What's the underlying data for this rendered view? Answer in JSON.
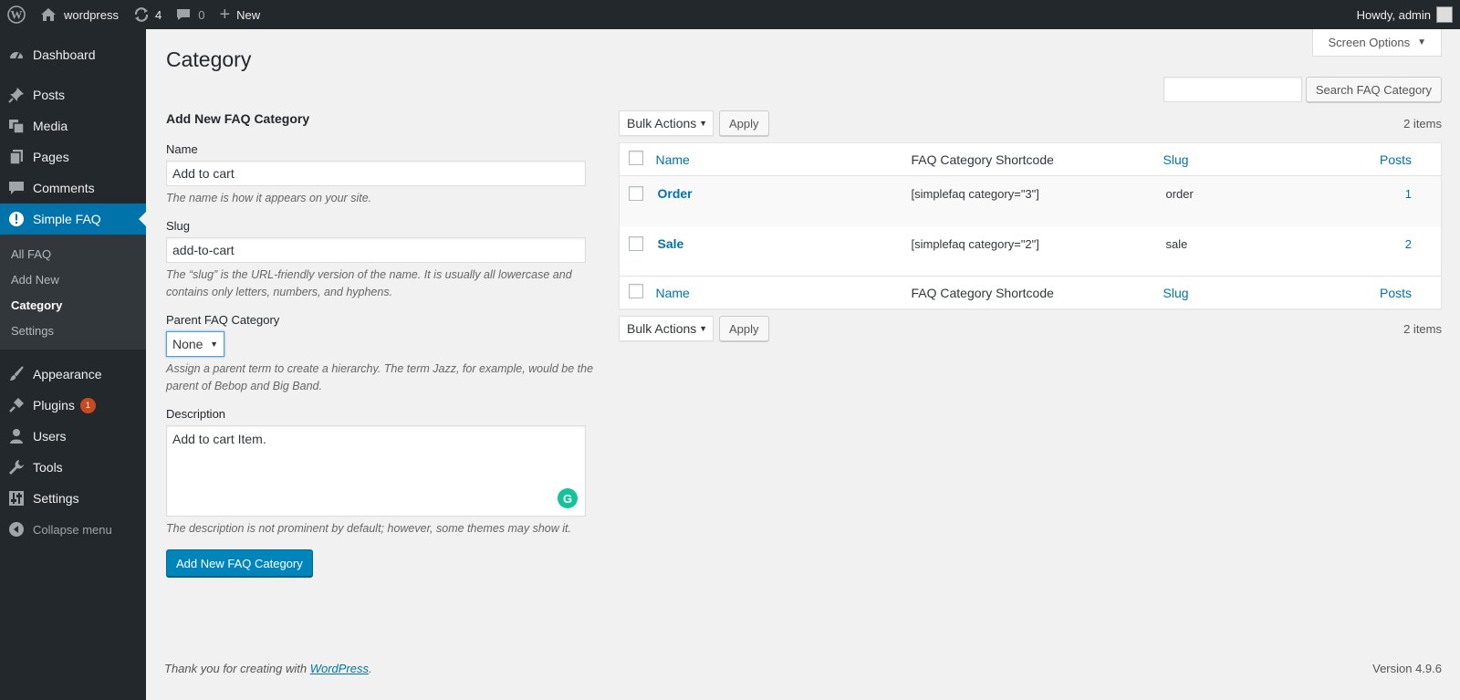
{
  "adminbar": {
    "site_name": "wordpress",
    "updates_count": "4",
    "comments_count": "0",
    "new_label": "New",
    "howdy": "Howdy, admin"
  },
  "sidebar": {
    "items": [
      {
        "label": "Dashboard",
        "icon": "dashboard-icon"
      },
      {
        "label": "Posts",
        "icon": "pin-icon"
      },
      {
        "label": "Media",
        "icon": "media-icon"
      },
      {
        "label": "Pages",
        "icon": "pages-icon"
      },
      {
        "label": "Comments",
        "icon": "comments-icon"
      },
      {
        "label": "Simple FAQ",
        "icon": "exclamation-icon"
      }
    ],
    "submenu": [
      "All FAQ",
      "Add New",
      "Category",
      "Settings"
    ],
    "items2": [
      {
        "label": "Appearance",
        "icon": "brush-icon"
      },
      {
        "label": "Plugins",
        "icon": "plug-icon",
        "badge": "1"
      },
      {
        "label": "Users",
        "icon": "user-icon"
      },
      {
        "label": "Tools",
        "icon": "wrench-icon"
      },
      {
        "label": "Settings",
        "icon": "sliders-icon"
      }
    ],
    "collapse": "Collapse menu"
  },
  "page": {
    "title": "Category",
    "screen_options": "Screen Options",
    "search_button": "Search FAQ Category"
  },
  "form": {
    "heading": "Add New FAQ Category",
    "name_label": "Name",
    "name_value": "Add to cart",
    "name_desc": "The name is how it appears on your site.",
    "slug_label": "Slug",
    "slug_value": "add-to-cart",
    "slug_desc": "The “slug” is the URL-friendly version of the name. It is usually all lowercase and contains only letters, numbers, and hyphens.",
    "parent_label": "Parent FAQ Category",
    "parent_value": "None",
    "parent_desc": "Assign a parent term to create a hierarchy. The term Jazz, for example, would be the parent of Bebop and Big Band.",
    "desc_label": "Description",
    "desc_value": "Add to cart Item.",
    "desc_desc": "The description is not prominent by default; however, some themes may show it.",
    "submit": "Add New FAQ Category"
  },
  "list": {
    "bulk_actions": "Bulk Actions",
    "apply": "Apply",
    "items_count": "2 items",
    "columns": [
      "Name",
      "FAQ Category Shortcode",
      "Slug",
      "Posts"
    ],
    "rows": [
      {
        "name": "Order",
        "shortcode": "[simplefaq category=\"3\"]",
        "slug": "order",
        "posts": "1"
      },
      {
        "name": "Sale",
        "shortcode": "[simplefaq category=\"2\"]",
        "slug": "sale",
        "posts": "2"
      }
    ]
  },
  "footer": {
    "thanks_prefix": "Thank you for creating with ",
    "thanks_link": "WordPress",
    "thanks_suffix": ".",
    "version": "Version 4.9.6"
  }
}
